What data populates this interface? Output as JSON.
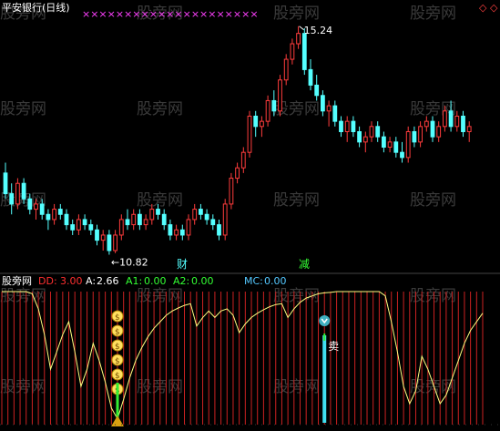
{
  "colors": {
    "background": "#000000",
    "up_candle": "#ff3c3c",
    "down_candle": "#54ffff",
    "xmark": "#ff40ff",
    "dd": "#ff3030",
    "a": "#ffffff",
    "a1": "#33ff33",
    "a2": "#33ff33",
    "mc": "#54c8ff",
    "indicator_line": "#ffff80",
    "bars": "#cc2222",
    "coin": "#ffe060",
    "buy_arrow": "#33ee33",
    "sell_bar": "#40e0f0",
    "chinese_label": "#54ffff",
    "watermark": "#3a3a3a"
  },
  "watermark_text": "股旁网",
  "chart_data": [
    {
      "type": "candlestick",
      "title": "平安银行(日线)",
      "annotations": {
        "high_label": "15.24",
        "low_label": "10.82",
        "markers": [
          "财",
          "减"
        ]
      },
      "ohlc": [
        [
          12.4,
          12.6,
          11.9,
          12.0
        ],
        [
          12.0,
          12.2,
          11.6,
          11.8
        ],
        [
          11.8,
          12.3,
          11.7,
          12.2
        ],
        [
          12.2,
          12.3,
          11.8,
          11.9
        ],
        [
          11.9,
          12.0,
          11.6,
          11.7
        ],
        [
          11.7,
          11.9,
          11.5,
          11.8
        ],
        [
          11.8,
          11.9,
          11.5,
          11.6
        ],
        [
          11.6,
          11.7,
          11.3,
          11.5
        ],
        [
          11.5,
          11.8,
          11.4,
          11.7
        ],
        [
          11.7,
          11.8,
          11.5,
          11.6
        ],
        [
          11.6,
          11.7,
          11.3,
          11.4
        ],
        [
          11.4,
          11.5,
          11.2,
          11.3
        ],
        [
          11.3,
          11.6,
          11.2,
          11.5
        ],
        [
          11.5,
          11.6,
          11.3,
          11.4
        ],
        [
          11.4,
          11.5,
          11.2,
          11.3
        ],
        [
          11.3,
          11.4,
          11.0,
          11.1
        ],
        [
          11.1,
          11.3,
          10.9,
          11.2
        ],
        [
          11.2,
          11.3,
          10.82,
          10.9
        ],
        [
          10.9,
          11.3,
          10.85,
          11.2
        ],
        [
          11.2,
          11.6,
          11.1,
          11.5
        ],
        [
          11.5,
          11.7,
          11.3,
          11.4
        ],
        [
          11.4,
          11.7,
          11.3,
          11.6
        ],
        [
          11.6,
          11.7,
          11.3,
          11.4
        ],
        [
          11.4,
          11.6,
          11.3,
          11.5
        ],
        [
          11.5,
          11.8,
          11.4,
          11.7
        ],
        [
          11.7,
          11.8,
          11.5,
          11.6
        ],
        [
          11.6,
          11.7,
          11.3,
          11.4
        ],
        [
          11.4,
          11.5,
          11.1,
          11.2
        ],
        [
          11.2,
          11.4,
          11.1,
          11.3
        ],
        [
          11.3,
          11.4,
          11.1,
          11.2
        ],
        [
          11.2,
          11.6,
          11.1,
          11.5
        ],
        [
          11.5,
          11.8,
          11.4,
          11.7
        ],
        [
          11.7,
          11.8,
          11.5,
          11.6
        ],
        [
          11.6,
          11.7,
          11.4,
          11.5
        ],
        [
          11.5,
          11.6,
          11.3,
          11.4
        ],
        [
          11.4,
          11.5,
          11.1,
          11.2
        ],
        [
          11.2,
          11.9,
          11.1,
          11.8
        ],
        [
          11.8,
          12.4,
          11.7,
          12.3
        ],
        [
          12.3,
          12.6,
          12.2,
          12.5
        ],
        [
          12.5,
          12.9,
          12.4,
          12.8
        ],
        [
          12.8,
          13.6,
          12.7,
          13.5
        ],
        [
          13.5,
          13.6,
          13.1,
          13.3
        ],
        [
          13.3,
          13.5,
          13.1,
          13.4
        ],
        [
          13.4,
          13.9,
          13.3,
          13.8
        ],
        [
          13.8,
          14.0,
          13.5,
          13.6
        ],
        [
          13.6,
          14.3,
          13.5,
          14.2
        ],
        [
          14.2,
          14.7,
          14.1,
          14.6
        ],
        [
          14.6,
          15.0,
          14.5,
          14.9
        ],
        [
          14.9,
          15.24,
          14.8,
          15.1
        ],
        [
          15.1,
          15.2,
          14.3,
          14.4
        ],
        [
          14.4,
          14.6,
          14.0,
          14.1
        ],
        [
          14.1,
          14.3,
          13.8,
          13.9
        ],
        [
          13.9,
          14.0,
          13.5,
          13.6
        ],
        [
          13.6,
          13.8,
          13.3,
          13.7
        ],
        [
          13.7,
          13.8,
          13.3,
          13.4
        ],
        [
          13.4,
          13.5,
          13.1,
          13.2
        ],
        [
          13.2,
          13.5,
          13.0,
          13.4
        ],
        [
          13.4,
          13.5,
          13.1,
          13.2
        ],
        [
          13.2,
          13.3,
          12.9,
          13.0
        ],
        [
          13.0,
          13.2,
          12.8,
          13.1
        ],
        [
          13.1,
          13.4,
          13.0,
          13.3
        ],
        [
          13.3,
          13.4,
          13.0,
          13.1
        ],
        [
          13.1,
          13.2,
          12.8,
          12.9
        ],
        [
          12.9,
          13.1,
          12.8,
          13.0
        ],
        [
          13.0,
          13.1,
          12.7,
          12.8
        ],
        [
          12.8,
          13.0,
          12.6,
          12.7
        ],
        [
          12.7,
          13.3,
          12.6,
          13.2
        ],
        [
          13.2,
          13.3,
          12.9,
          13.0
        ],
        [
          13.0,
          13.4,
          12.9,
          13.3
        ],
        [
          13.3,
          13.5,
          13.2,
          13.4
        ],
        [
          13.4,
          13.5,
          13.0,
          13.1
        ],
        [
          13.1,
          13.4,
          13.0,
          13.3
        ],
        [
          13.3,
          13.7,
          13.2,
          13.6
        ],
        [
          13.6,
          13.8,
          13.2,
          13.3
        ],
        [
          13.3,
          13.6,
          13.2,
          13.5
        ],
        [
          13.5,
          13.6,
          13.1,
          13.2
        ],
        [
          13.2,
          13.4,
          13.0,
          13.3
        ]
      ],
      "xmark_row": "×××××××××××××××××××××"
    },
    {
      "type": "line",
      "legend": [
        {
          "name": "DD:",
          "value": "3.00"
        },
        {
          "name": "A:",
          "value": "2.66"
        },
        {
          "name": "A1:",
          "value": "0.00"
        },
        {
          "name": "A2:",
          "value": "0.00"
        },
        {
          "name": "MC:",
          "value": "0.00"
        }
      ],
      "sell_label": "卖",
      "series": [
        {
          "values": [
            3.0,
            3.0,
            3.0,
            3.0,
            3.0,
            2.95,
            2.6,
            2.0,
            1.2,
            1.6,
            2.0,
            2.3,
            1.6,
            0.8,
            1.2,
            1.8,
            1.4,
            0.9,
            0.3,
            0.05,
            0.5,
            1.0,
            1.4,
            1.7,
            1.95,
            2.15,
            2.3,
            2.45,
            2.55,
            2.62,
            2.68,
            2.72,
            2.2,
            2.4,
            2.55,
            2.4,
            2.55,
            2.6,
            2.45,
            2.05,
            2.25,
            2.4,
            2.5,
            2.58,
            2.65,
            2.7,
            2.72,
            2.4,
            2.6,
            2.75,
            2.85,
            2.9,
            2.95,
            2.97,
            2.98,
            3.0,
            3.0,
            3.0,
            3.0,
            3.0,
            3.0,
            3.0,
            3.0,
            2.9,
            2.3,
            1.6,
            0.8,
            0.4,
            0.7,
            1.5,
            1.2,
            0.8,
            0.4,
            0.6,
            1.0,
            1.4,
            1.8,
            2.1,
            2.3,
            2.5
          ]
        }
      ]
    }
  ]
}
